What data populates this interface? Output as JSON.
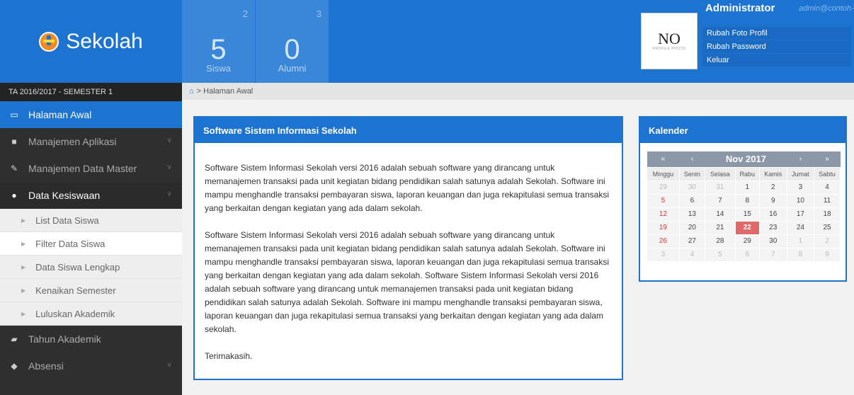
{
  "brand": {
    "title": "Sekolah"
  },
  "stats": [
    {
      "count_top": "2",
      "count_big": "5",
      "label": "Siswa"
    },
    {
      "count_top": "3",
      "count_big": "0",
      "label": "Alumni"
    }
  ],
  "profile": {
    "photo_text": "NO",
    "photo_sub": "PROFILE PHOTO",
    "name": "Administrator",
    "email": "admin@contoh-email.com",
    "menu": [
      "Rubah Foto Profil",
      "Rubah Password",
      "Keluar"
    ]
  },
  "sidebar": {
    "semester": "TA 2016/2017 - SEMESTER 1",
    "items": [
      {
        "label": "Halaman Awal",
        "icon": "laptop-icon"
      },
      {
        "label": "Manajemen Aplikasi",
        "icon": "briefcase-icon"
      },
      {
        "label": "Manajemen Data Master",
        "icon": "pencil-icon"
      },
      {
        "label": "Data Kesiswaan",
        "icon": "users-icon"
      },
      {
        "label": "Tahun Akademik",
        "icon": "book-icon"
      },
      {
        "label": "Absensi",
        "icon": "tag-icon"
      }
    ],
    "subitems": [
      "List Data Siswa",
      "Filter Data Siswa",
      "Data Siswa Lengkap",
      "Kenaikan Semester",
      "Luluskan Akademik"
    ]
  },
  "breadcrumb": {
    "current": "Halaman Awal"
  },
  "main_panel": {
    "title": "Software Sistem Informasi Sekolah",
    "para1": "Software Sistem Informasi Sekolah versi 2016 adalah sebuah software yang dirancang untuk memanajemen transaksi pada unit kegiatan bidang pendidikan salah satunya adalah Sekolah. Software ini mampu menghandle transaksi pembayaran siswa, laporan keuangan dan juga rekapitulasi semua transaksi yang berkaitan dengan kegiatan yang ada dalam sekolah.",
    "para2": "Software Sistem Informasi Sekolah versi 2016 adalah sebuah software yang dirancang untuk memanajemen transaksi pada unit kegiatan bidang pendidikan salah satunya adalah Sekolah. Software ini mampu menghandle transaksi pembayaran siswa, laporan keuangan dan juga rekapitulasi semua transaksi yang berkaitan dengan kegiatan yang ada dalam sekolah. Software Sistem Informasi Sekolah versi 2016 adalah sebuah software yang dirancang untuk memanajemen transaksi pada unit kegiatan bidang pendidikan salah satunya adalah Sekolah. Software ini mampu menghandle transaksi pembayaran siswa, laporan keuangan dan juga rekapitulasi semua transaksi yang berkaitan dengan kegiatan yang ada dalam sekolah.",
    "closing": "Terimakasih."
  },
  "calendar": {
    "title": "Kalender",
    "prev_year": "«",
    "prev_month": "‹",
    "month": "Nov 2017",
    "next_month": "›",
    "next_year": "»",
    "days": [
      "Minggu",
      "Senin",
      "Selasa",
      "Rabu",
      "Kamis",
      "Jumat",
      "Sabtu"
    ],
    "weeks": [
      [
        "29",
        "30",
        "31",
        "1",
        "2",
        "3",
        "4"
      ],
      [
        "5",
        "6",
        "7",
        "8",
        "9",
        "10",
        "11"
      ],
      [
        "12",
        "13",
        "14",
        "15",
        "16",
        "17",
        "18"
      ],
      [
        "19",
        "20",
        "21",
        "22",
        "23",
        "24",
        "25"
      ],
      [
        "26",
        "27",
        "28",
        "29",
        "30",
        "1",
        "2"
      ],
      [
        "3",
        "4",
        "5",
        "6",
        "7",
        "8",
        "9"
      ]
    ],
    "today": "22"
  },
  "colors": {
    "primary": "#1d73d0",
    "sidebar": "#2f2f2f",
    "today": "#e06a6a"
  }
}
